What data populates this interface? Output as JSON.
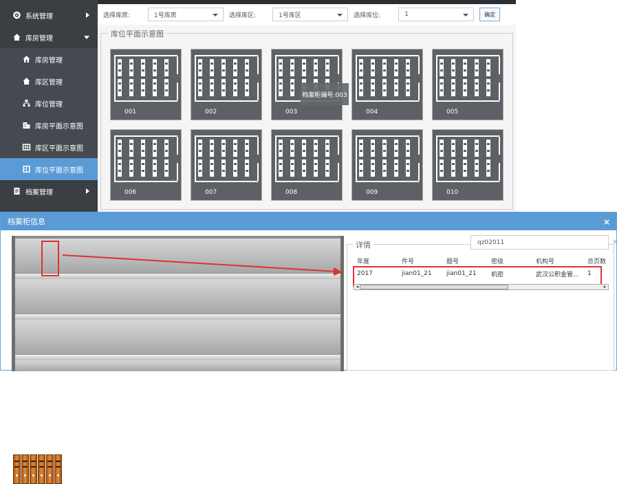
{
  "sidebar": {
    "items": [
      {
        "label": "系统管理",
        "icon": "gear-icon",
        "level": "top",
        "arrow": "right"
      },
      {
        "label": "库房管理",
        "icon": "home-icon",
        "level": "top",
        "arrow": "down"
      },
      {
        "label": "库房管理",
        "icon": "home-icon",
        "level": "sub"
      },
      {
        "label": "库区管理",
        "icon": "home-filled-icon",
        "level": "sub"
      },
      {
        "label": "库位管理",
        "icon": "sitemap-icon",
        "level": "sub"
      },
      {
        "label": "库房平面示意图",
        "icon": "building-icon",
        "level": "sub"
      },
      {
        "label": "库区平面示意图",
        "icon": "grid-icon",
        "level": "sub"
      },
      {
        "label": "库位平面示意图",
        "icon": "layout-icon",
        "level": "sub",
        "active": true
      },
      {
        "label": "档案管理",
        "icon": "file-icon",
        "level": "top",
        "arrow": "right"
      }
    ]
  },
  "toolbar": {
    "warehouse_label": "选择库房:",
    "warehouse_value": "1号库房",
    "area_label": "选择库区:",
    "area_value": "1号库区",
    "slot_label": "选择库位:",
    "slot_value": "1",
    "confirm_label": "确定"
  },
  "map": {
    "legend": "库位平面示意图",
    "cabinets": [
      "001",
      "002",
      "003",
      "004",
      "005",
      "006",
      "007",
      "008",
      "009",
      "010"
    ],
    "tooltip": "档案柜编号:003"
  },
  "dialog": {
    "title": "档案柜信息",
    "close": "×",
    "detail_legend": "详情",
    "search_value": "qz02011",
    "search_clear": "×",
    "columns": [
      "年度",
      "件号",
      "题号",
      "密级",
      "机构号",
      "总页数"
    ],
    "rows": [
      [
        "2017",
        "jian01_21",
        "jian01_21",
        "机密",
        "武汉公积金管...",
        "1"
      ]
    ]
  },
  "colors": {
    "sidebar_bg": "#3a3f44",
    "active": "#5b9bd5",
    "highlight": "#e03030",
    "cabinet": "#5d6166"
  }
}
